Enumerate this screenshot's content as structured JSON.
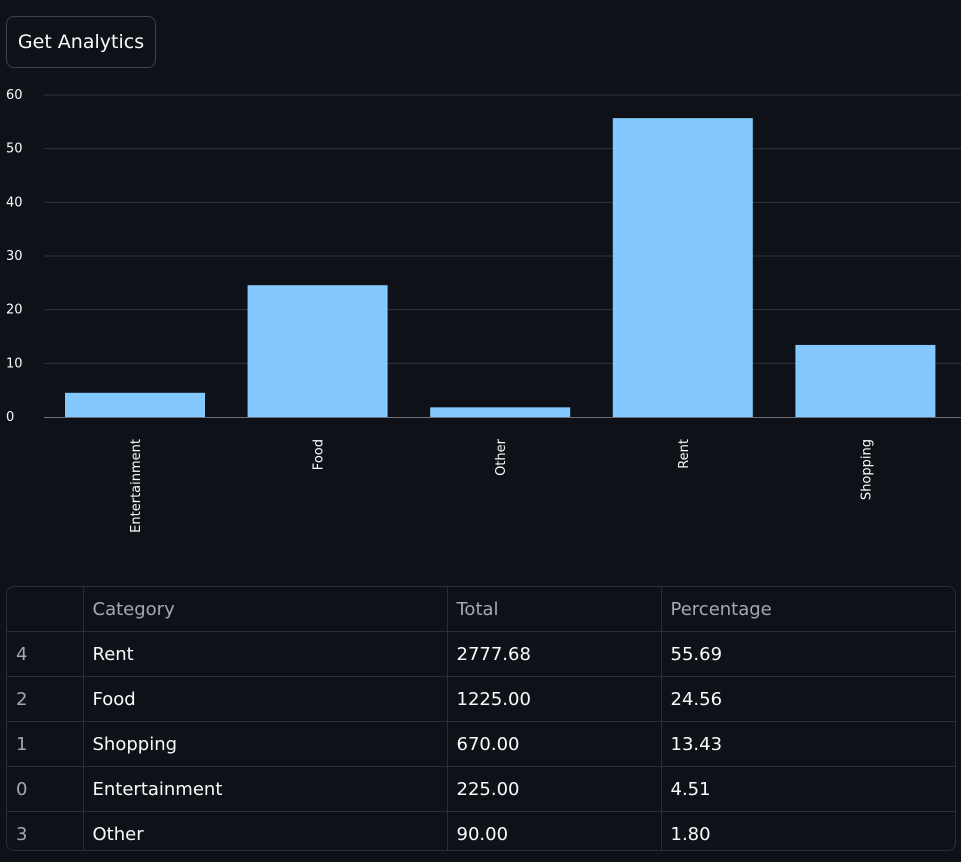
{
  "button": {
    "label": "Get Analytics"
  },
  "colors": {
    "bar": "#83c9ff",
    "background": "#0e1117",
    "grid": "#31333f"
  },
  "chart_data": {
    "type": "bar",
    "categories": [
      "Entertainment",
      "Food",
      "Other",
      "Rent",
      "Shopping"
    ],
    "values": [
      4.51,
      24.56,
      1.8,
      55.69,
      13.43
    ],
    "ylim": [
      0,
      60
    ],
    "yticks": [
      0,
      10,
      20,
      30,
      40,
      50,
      60
    ],
    "grid": true,
    "xlabel": "",
    "ylabel": ""
  },
  "table": {
    "columns": [
      "",
      "Category",
      "Total",
      "Percentage"
    ],
    "rows": [
      [
        "4",
        "Rent",
        "2777.68",
        "55.69"
      ],
      [
        "2",
        "Food",
        "1225.00",
        "24.56"
      ],
      [
        "1",
        "Shopping",
        "670.00",
        "13.43"
      ],
      [
        "0",
        "Entertainment",
        "225.00",
        "4.51"
      ],
      [
        "3",
        "Other",
        "90.00",
        "1.80"
      ]
    ]
  }
}
